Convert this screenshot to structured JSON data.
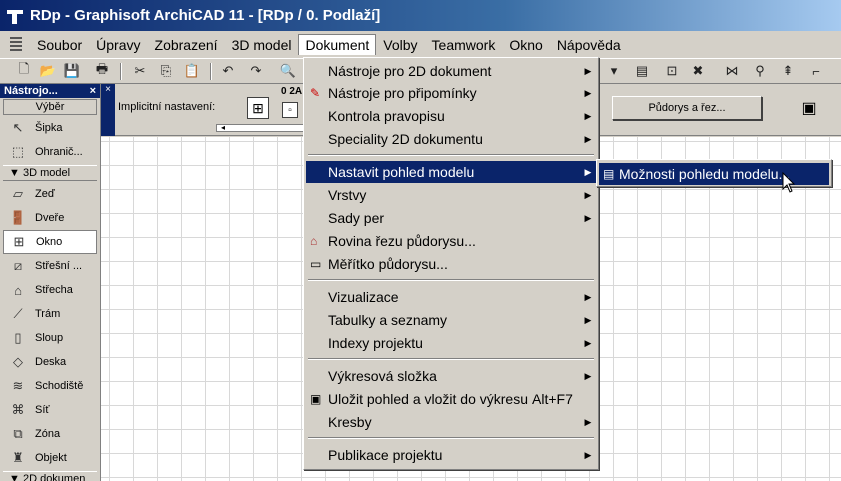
{
  "window": {
    "title": "RDp - Graphisoft ArchiCAD 11 - [RDp / 0. Podlaží]"
  },
  "menubar": {
    "items": [
      "Soubor",
      "Úpravy",
      "Zobrazení",
      "3D model",
      "Dokument",
      "Volby",
      "Teamwork",
      "Okno",
      "Nápověda"
    ],
    "active": "Dokument"
  },
  "toolbox": {
    "title": "Nástrojo...",
    "close": "×",
    "header": "Výběr",
    "sections": {
      "model": "3D model",
      "doc": "2D dokumen"
    },
    "tools": [
      {
        "label": "Šipka",
        "icon": "arrow-icon"
      },
      {
        "label": "Ohranič...",
        "icon": "marquee-icon"
      },
      {
        "label": "Zeď",
        "icon": "wall-icon"
      },
      {
        "label": "Dveře",
        "icon": "door-icon"
      },
      {
        "label": "Okno",
        "icon": "window-icon",
        "selected": true
      },
      {
        "label": "Střešní ...",
        "icon": "skylight-icon"
      },
      {
        "label": "Střecha",
        "icon": "roof-icon"
      },
      {
        "label": "Trám",
        "icon": "beam-icon"
      },
      {
        "label": "Sloup",
        "icon": "column-icon"
      },
      {
        "label": "Deska",
        "icon": "slab-icon"
      },
      {
        "label": "Schodiště",
        "icon": "stair-icon"
      },
      {
        "label": "Síť",
        "icon": "mesh-icon"
      },
      {
        "label": "Zóna",
        "icon": "zone-icon"
      },
      {
        "label": "Objekt",
        "icon": "object-icon"
      }
    ]
  },
  "infobox": {
    "label": "Implicitní nastavení:",
    "small_label": "0 2A",
    "pudorys_button": "Půdorys a řez...",
    "close": "×"
  },
  "dokument_menu": {
    "items": [
      {
        "label": "Nástroje pro 2D dokument",
        "submenu": true
      },
      {
        "label": "Nástroje pro připomínky",
        "submenu": true,
        "icon": "markup-icon"
      },
      {
        "label": "Kontrola pravopisu",
        "submenu": true
      },
      {
        "label": "Speciality 2D dokumentu",
        "submenu": true
      },
      {
        "label": "Nastavit pohled modelu",
        "submenu": true,
        "highlight": true
      },
      {
        "label": "Vrstvy",
        "submenu": true
      },
      {
        "label": "Sady per",
        "submenu": true
      },
      {
        "label": "Rovina řezu půdorysu...",
        "icon": "cut-plane-icon"
      },
      {
        "label": "Měřítko půdorysu...",
        "icon": "scale-icon"
      },
      {
        "label": "Vizualizace",
        "submenu": true
      },
      {
        "label": "Tabulky a seznamy",
        "submenu": true
      },
      {
        "label": "Indexy projektu",
        "submenu": true
      },
      {
        "label": "Výkresová složka",
        "submenu": true
      },
      {
        "label": "Uložit pohled a vložit do výkresu",
        "shortcut": "Alt+F7",
        "icon": "save-view-icon"
      },
      {
        "label": "Kresby",
        "submenu": true
      },
      {
        "label": "Publikace projektu",
        "submenu": true
      }
    ]
  },
  "submenu": {
    "item": "Možnosti pohledu modelu..."
  }
}
